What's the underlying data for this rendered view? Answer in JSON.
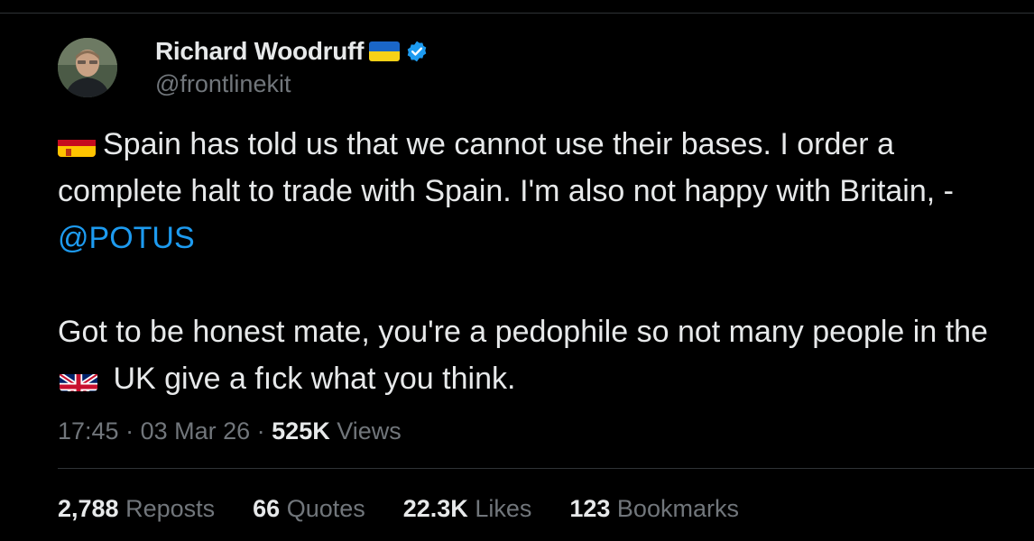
{
  "author": {
    "name": "Richard Woodruff",
    "handle": "@frontlinekit",
    "flag_icon": "ukraine-flag-icon",
    "verified_icon": "verified-badge-icon",
    "verified_color": "#1d9bf0"
  },
  "tweet": {
    "para1_text": "Spain has told us that we cannot use their bases. I order a complete halt to trade with Spain. I'm also not happy with Britain, - ",
    "para1_mention": "@POTUS",
    "para1_flag_icon": "spain-flag-icon",
    "para2_before": "Got to be honest mate, you're a pedophile so not many people in the ",
    "para2_flag_icon": "uk-flag-icon",
    "para2_after": " UK give a fıck what you think."
  },
  "meta": {
    "time": "17:45",
    "sep1": " · ",
    "date": "03 Mar 26",
    "sep2": " · ",
    "views_count": "525K",
    "views_label": " Views"
  },
  "stats": [
    {
      "count": "2,788",
      "label": " Reposts"
    },
    {
      "count": "66",
      "label": " Quotes"
    },
    {
      "count": "22.3K",
      "label": " Likes"
    },
    {
      "count": "123",
      "label": " Bookmarks"
    }
  ],
  "colors": {
    "background": "#000000",
    "text": "#e7e9ea",
    "secondary": "#71767b",
    "mention": "#1d9bf0",
    "divider": "#2f3336"
  }
}
